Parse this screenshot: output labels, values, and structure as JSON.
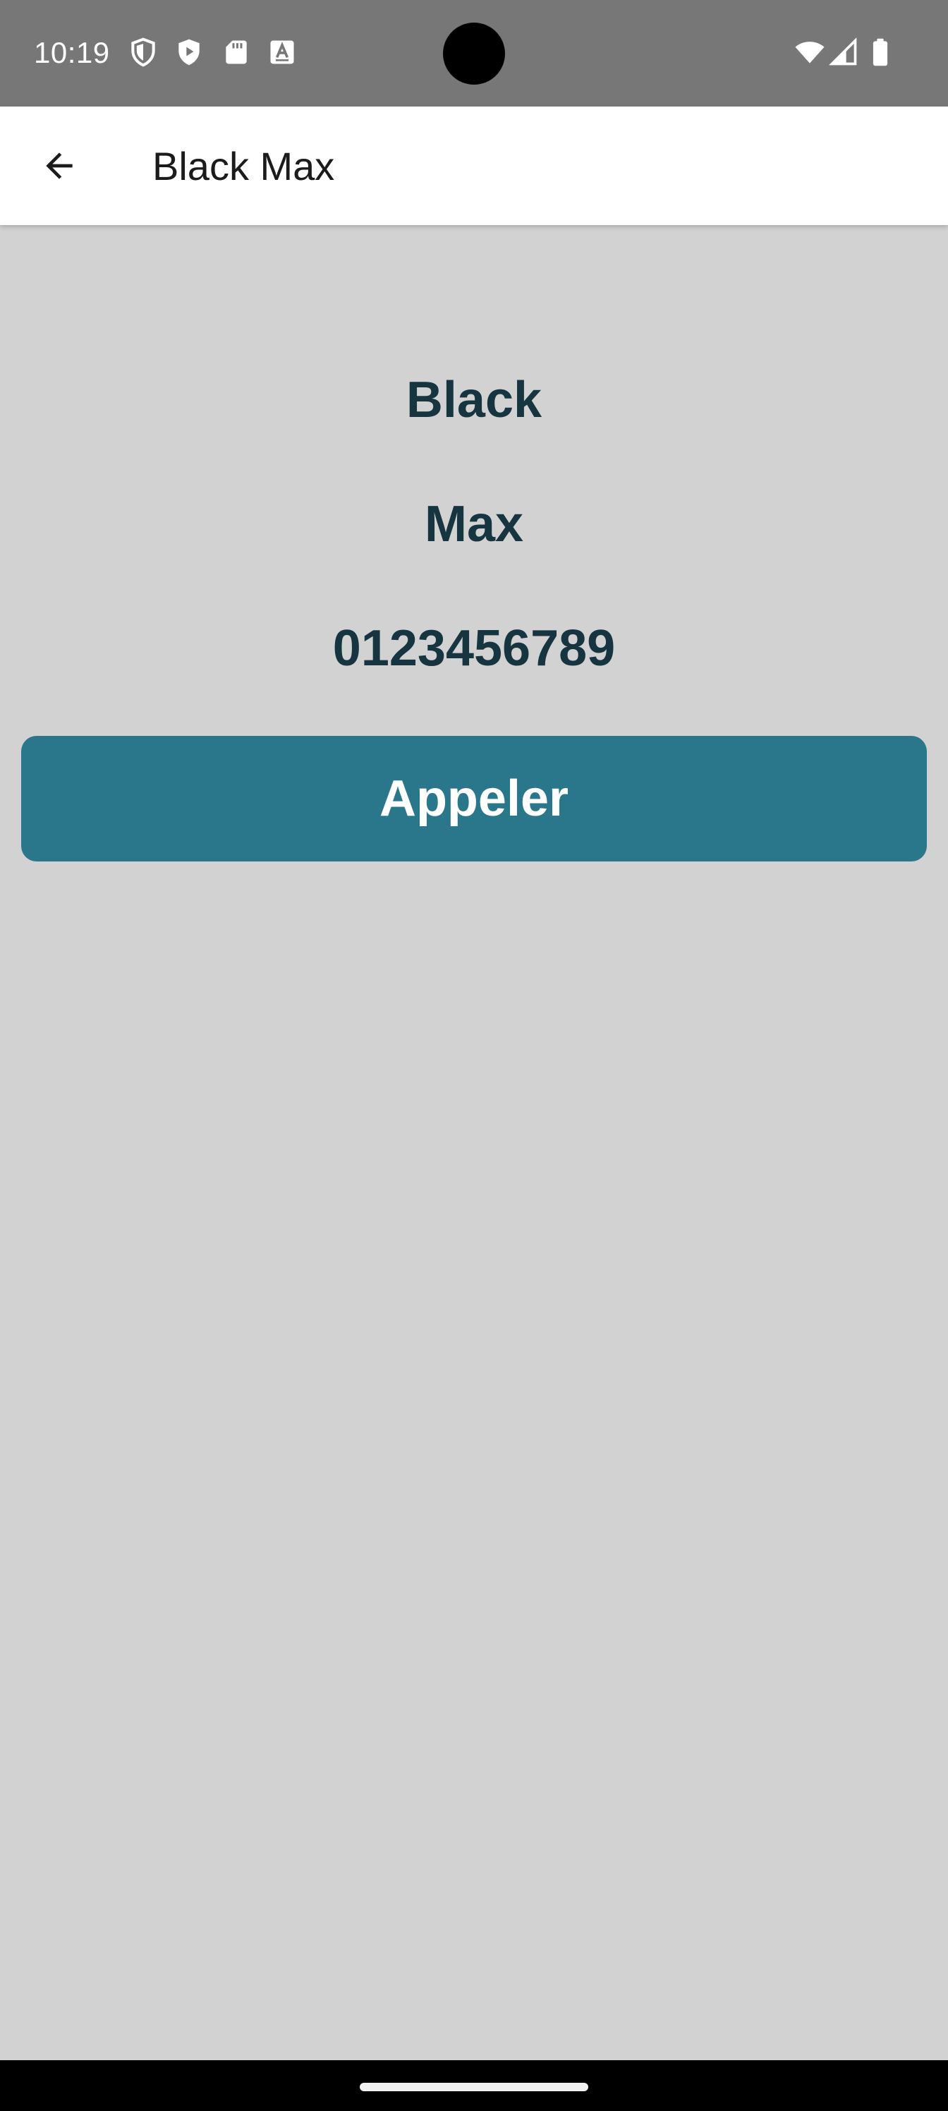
{
  "status_bar": {
    "time": "10:19",
    "left_icons": [
      "shield-outline-icon",
      "shield-play-icon",
      "sd-card-icon",
      "keyboard-a-icon"
    ],
    "right_icons": [
      "wifi-icon",
      "cell-signal-icon",
      "battery-icon"
    ],
    "background": "#777777"
  },
  "app_bar": {
    "title": "Black Max",
    "back_icon": "arrow-back-icon"
  },
  "contact": {
    "last_name": "Black",
    "first_name": "Max",
    "phone": "0123456789"
  },
  "actions": {
    "call_label": "Appeler"
  },
  "colors": {
    "screen_background": "#d2d2d2",
    "text_primary": "#163540",
    "button_accent": "#2a778c",
    "app_bar_background": "#ffffff"
  }
}
